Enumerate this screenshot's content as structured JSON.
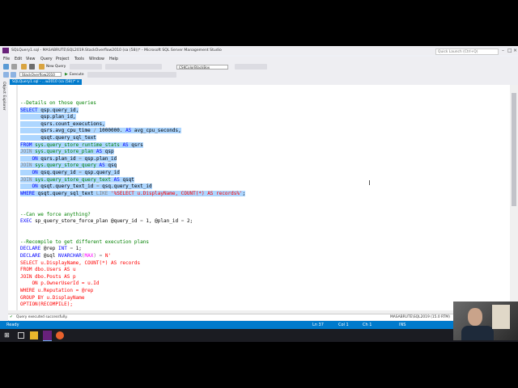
{
  "window": {
    "title": "SQLQuery1.sql - MASABRUTE\\SQL2019.StackOverflow2010 (sa (58))* - Microsoft SQL Server Management Studio",
    "quick_launch_placeholder": "Quick Launch (Ctrl+Q)"
  },
  "menu": [
    "File",
    "Edit",
    "View",
    "Query",
    "Project",
    "Tools",
    "Window",
    "Help"
  ],
  "toolbar": {
    "new_query_label": "New Query",
    "execute_label": "Execute",
    "database": "StackOverflow2010",
    "theme_combo": "CSKColorBlackBox"
  },
  "sidebar": {
    "object_explorer_label": "Object Explorer"
  },
  "tab": {
    "label": "SQLQuery1.sql - ...w2010 (sa (58))*"
  },
  "editor": {
    "lines": [
      [
        [
          "c-com",
          "--Details on those queries"
        ]
      ],
      [
        [
          "c-kw",
          "SELECT"
        ],
        [
          "c-blk",
          " qsp.query_id,"
        ]
      ],
      [
        [
          "c-blk",
          "       qsp.plan_id,"
        ]
      ],
      [
        [
          "c-blk",
          "       qsrs.count_executions,"
        ]
      ],
      [
        [
          "c-blk",
          "       qsrs.avg_cpu_time "
        ],
        [
          "c-gray",
          "/"
        ],
        [
          "c-blk",
          " 1000000. "
        ],
        [
          "c-kw",
          "AS"
        ],
        [
          "c-blk",
          " avg_cpu_seconds,"
        ]
      ],
      [
        [
          "c-blk",
          "       qsqt.query_sql_text"
        ]
      ],
      [
        [
          "c-kw",
          "FROM"
        ],
        [
          "c-sys",
          " sys.query_store_runtime_stats"
        ],
        [
          "c-kw",
          " AS"
        ],
        [
          "c-blk",
          " qsrs"
        ]
      ],
      [
        [
          "c-gray",
          "JOIN"
        ],
        [
          "c-sys",
          " sys.query_store_plan"
        ],
        [
          "c-kw",
          " AS"
        ],
        [
          "c-blk",
          " qsp"
        ]
      ],
      [
        [
          "c-blk",
          "    "
        ],
        [
          "c-kw",
          "ON"
        ],
        [
          "c-blk",
          " qsrs.plan_id "
        ],
        [
          "c-gray",
          "="
        ],
        [
          "c-blk",
          " qsp.plan_id"
        ]
      ],
      [
        [
          "c-gray",
          "JOIN"
        ],
        [
          "c-sys",
          " sys.query_store_query"
        ],
        [
          "c-kw",
          " AS"
        ],
        [
          "c-blk",
          " qsq"
        ]
      ],
      [
        [
          "c-blk",
          "    "
        ],
        [
          "c-kw",
          "ON"
        ],
        [
          "c-blk",
          " qsq.query_id "
        ],
        [
          "c-gray",
          "="
        ],
        [
          "c-blk",
          " qsp.query_id"
        ]
      ],
      [
        [
          "c-gray",
          "JOIN"
        ],
        [
          "c-sys",
          " sys.query_store_query_text"
        ],
        [
          "c-kw",
          " AS"
        ],
        [
          "c-blk",
          " qsqt"
        ]
      ],
      [
        [
          "c-blk",
          "    "
        ],
        [
          "c-kw",
          "ON"
        ],
        [
          "c-blk",
          " qsqt.query_text_id "
        ],
        [
          "c-gray",
          "="
        ],
        [
          "c-blk",
          " qsq.query_text_id"
        ]
      ],
      [
        [
          "c-kw",
          "WHERE"
        ],
        [
          "c-blk",
          " qsqt.query_sql_text "
        ],
        [
          "c-gray",
          "LIKE"
        ],
        [
          "c-str",
          " '%SELECT u.DisplayName, COUNT(*) AS records%'"
        ],
        [
          "c-blk",
          ";"
        ]
      ],
      [],
      [],
      [
        [
          "c-com",
          "--Can we force anything?"
        ]
      ],
      [
        [
          "c-kw",
          "EXEC"
        ],
        [
          "c-blk",
          " sp_query_store_force_plan @query_id "
        ],
        [
          "c-gray",
          "="
        ],
        [
          "c-blk",
          " 1, @plan_id "
        ],
        [
          "c-gray",
          "="
        ],
        [
          "c-blk",
          " 2;"
        ]
      ],
      [],
      [],
      [
        [
          "c-com",
          "--Recompile to get different execution plans"
        ]
      ],
      [
        [
          "c-kw",
          "DECLARE"
        ],
        [
          "c-blk",
          " @rep "
        ],
        [
          "c-kw",
          "INT"
        ],
        [
          "c-gray",
          " ="
        ],
        [
          "c-blk",
          " 1;"
        ]
      ],
      [
        [
          "c-kw",
          "DECLARE"
        ],
        [
          "c-blk",
          " @sql "
        ],
        [
          "c-kw",
          "NVARCHAR"
        ],
        [
          "c-gray",
          "("
        ],
        [
          "c-fn",
          "MAX"
        ],
        [
          "c-gray",
          ")"
        ],
        [
          "c-gray",
          " ="
        ],
        [
          "c-str",
          " N'"
        ]
      ],
      [
        [
          "c-str",
          "SELECT u.DisplayName, COUNT(*) AS records"
        ]
      ],
      [
        [
          "c-str",
          "FROM dbo.Users AS u"
        ]
      ],
      [
        [
          "c-str",
          "JOIN dbo.Posts AS p"
        ]
      ],
      [
        [
          "c-str",
          "    ON p.OwnerUserId = u.Id"
        ]
      ],
      [
        [
          "c-str",
          "WHERE u.Reputation = @rep"
        ]
      ],
      [
        [
          "c-str",
          "GROUP BY u.DisplayName"
        ]
      ],
      [
        [
          "c-str",
          "OPTION(RECOMPILE);"
        ]
      ]
    ],
    "selected_lines": [
      1,
      2,
      3,
      4,
      5,
      6,
      7,
      8,
      9,
      10,
      11,
      12,
      13
    ]
  },
  "message_bar": {
    "text": "Query executed successfully."
  },
  "status": {
    "ready": "Ready",
    "ln": "Ln 37",
    "col": "Col 1",
    "ch": "Ch 1",
    "ins": "INS",
    "server": "MASABRUTE\\SQL2019 (15.0 RTM)",
    "user": "sa (58)",
    "database": "StackOverflow2010",
    "time": "00:00:00",
    "rows": "0 rows"
  },
  "colors": {
    "accent": "#007acc",
    "selection": "#add6ff",
    "comment": "#008000",
    "keyword": "#0000ff",
    "string": "#ff0000",
    "taskbar": "#1b1c22"
  }
}
